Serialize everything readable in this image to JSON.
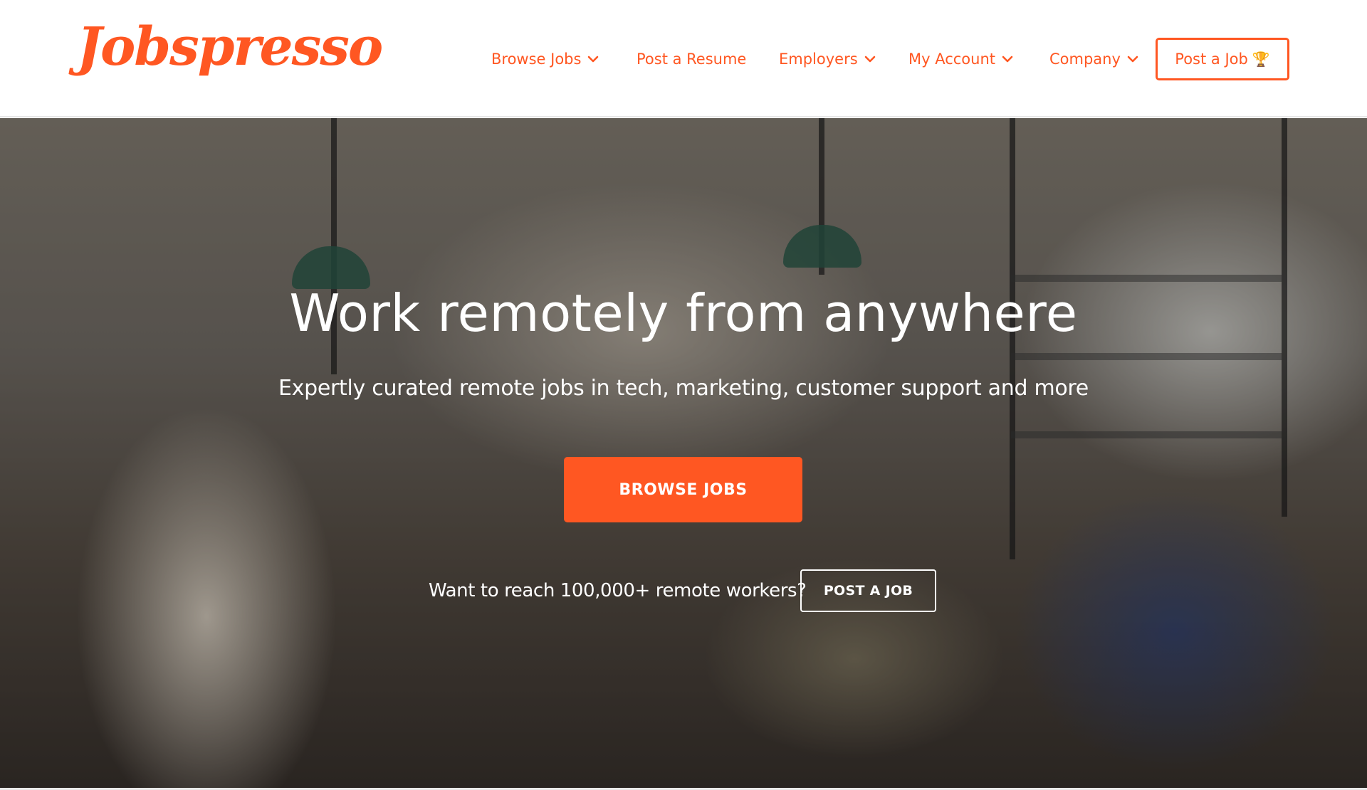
{
  "brand": {
    "name": "Jobspresso",
    "accent_color": "#FF5722"
  },
  "nav": {
    "items": [
      {
        "label": "Browse Jobs",
        "has_dropdown": true,
        "icon": "chevron-down-icon"
      },
      {
        "label": "Post a Resume",
        "has_dropdown": false
      },
      {
        "label": "Employers",
        "has_dropdown": true,
        "icon": "chevron-down-icon"
      },
      {
        "label": "My Account",
        "has_dropdown": true,
        "icon": "chevron-down-icon"
      },
      {
        "label": "Company",
        "has_dropdown": true,
        "icon": "chevron-down-icon"
      }
    ],
    "post_job": {
      "label": "Post a Job",
      "icon": "trophy-icon",
      "glyph": "🏆"
    }
  },
  "hero": {
    "headline": "Work remotely from anywhere",
    "subtitle": "Expertly curated remote jobs in tech, marketing, customer support and more",
    "primary_cta": "BROWSE JOBS",
    "secondary_prompt": "Want to reach 100,000+ remote workers?",
    "secondary_cta": "POST A JOB",
    "background": "cafe-photo"
  }
}
